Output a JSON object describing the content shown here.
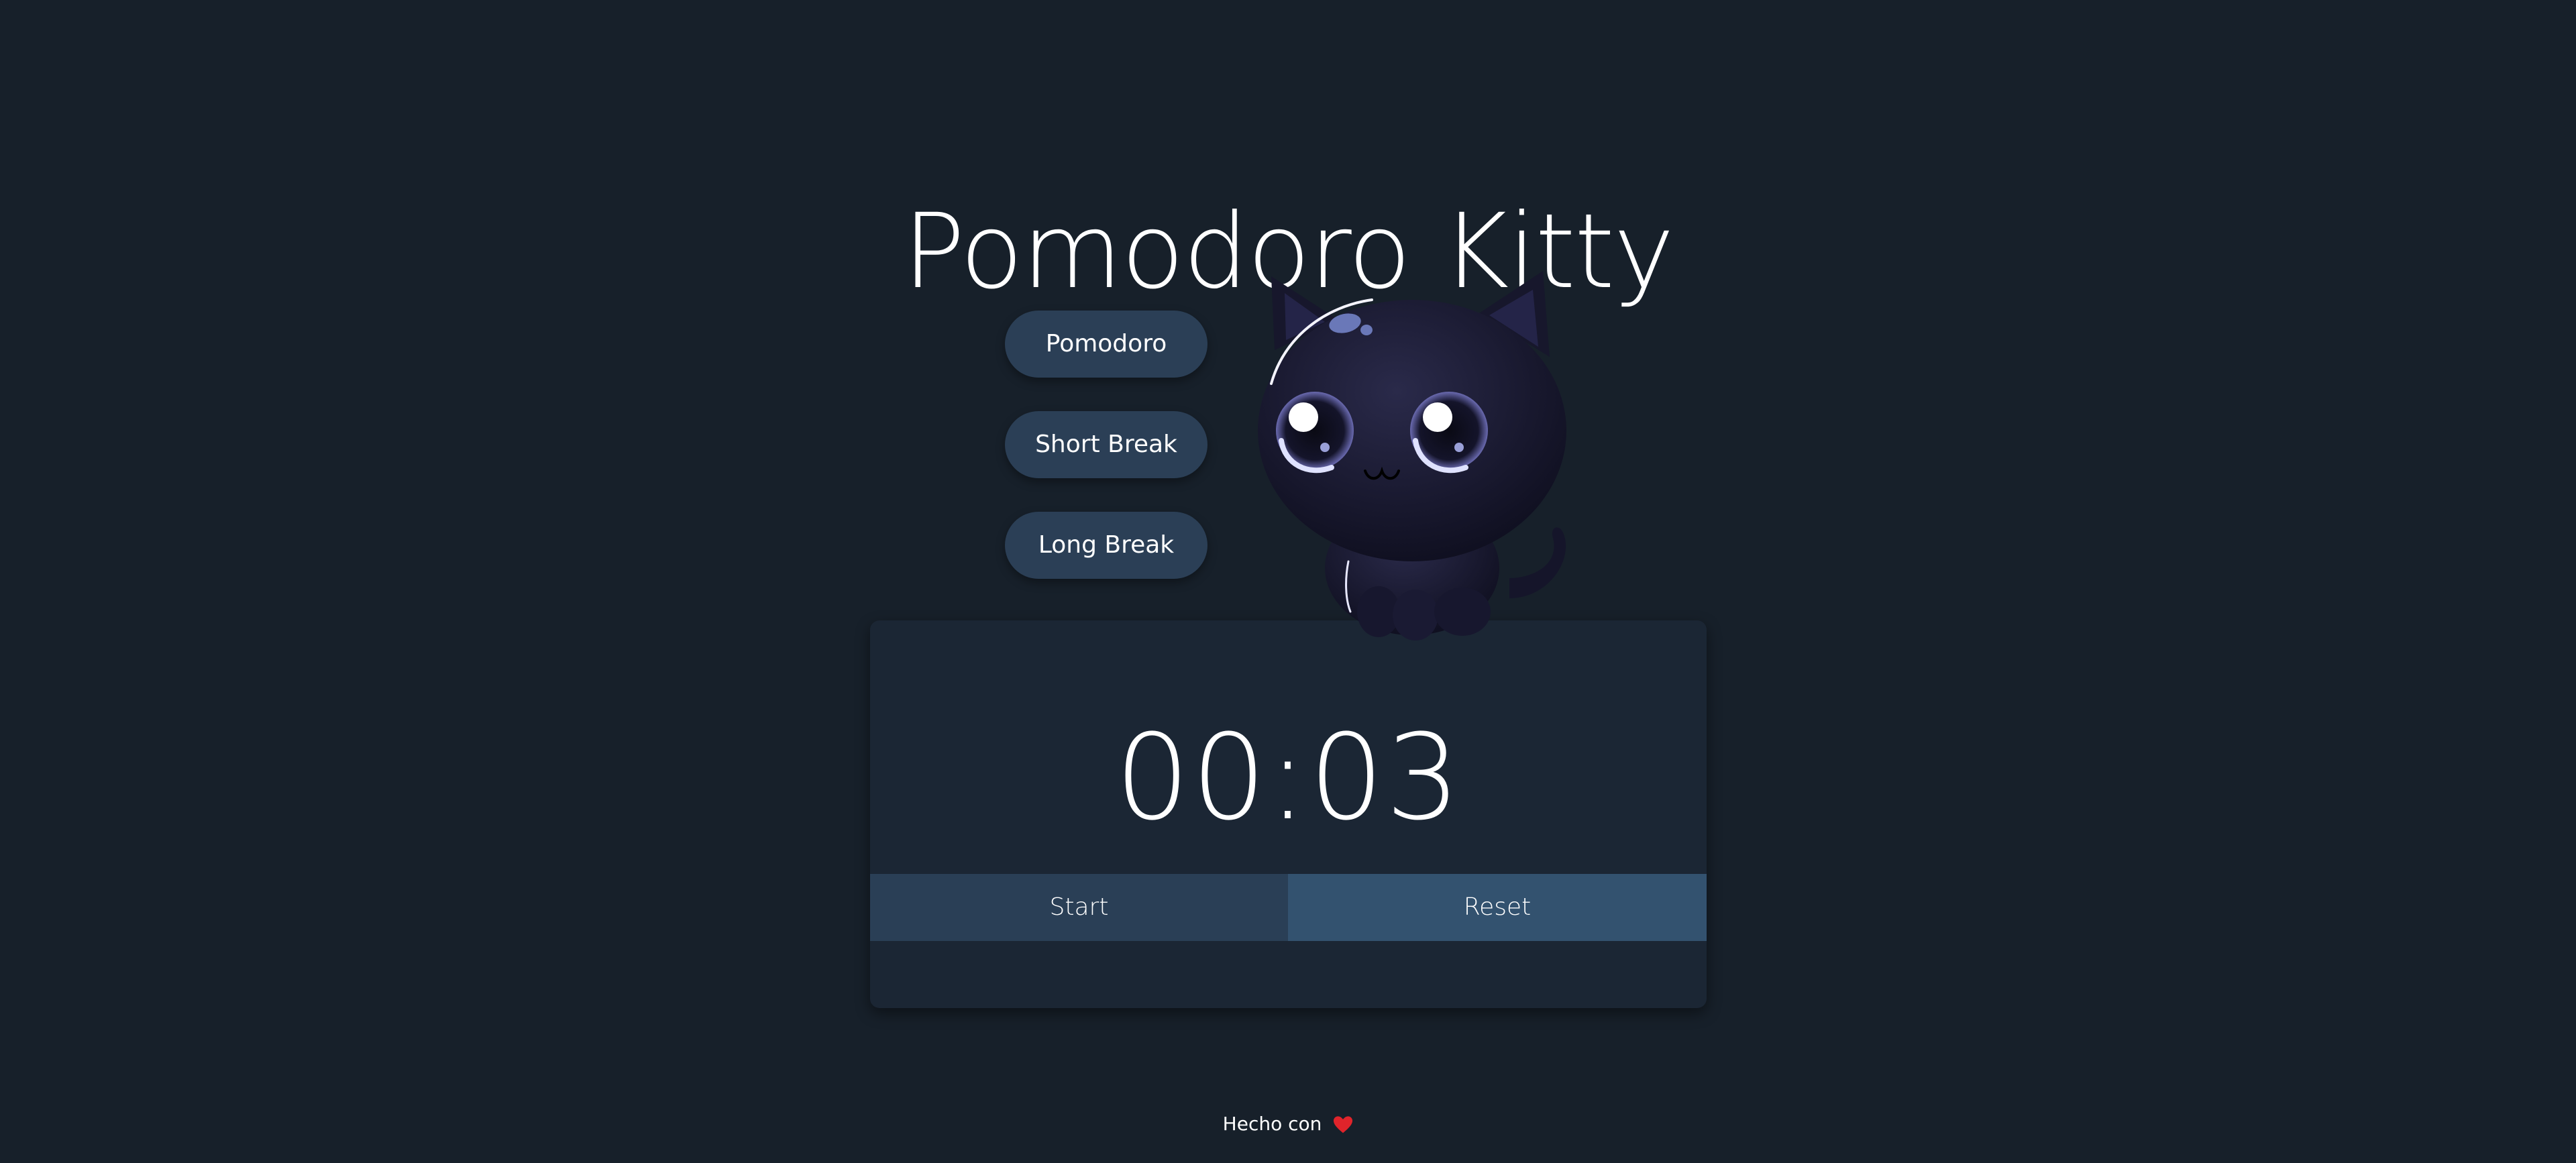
{
  "app": {
    "title": "Pomodoro Kitty"
  },
  "modes": {
    "pomodoro_label": "Pomodoro",
    "short_break_label": "Short Break",
    "long_break_label": "Long Break"
  },
  "timer": {
    "display": "00:03"
  },
  "controls": {
    "start_label": "Start",
    "reset_label": "Reset"
  },
  "footer": {
    "text": "Hecho con",
    "icon": "heart-icon"
  },
  "colors": {
    "background": "#17202a",
    "card": "#1b2634",
    "mode_button": "#2b3f56",
    "start_button": "#2a3f56",
    "reset_button": "#33526f",
    "heart": "#e0242b"
  }
}
